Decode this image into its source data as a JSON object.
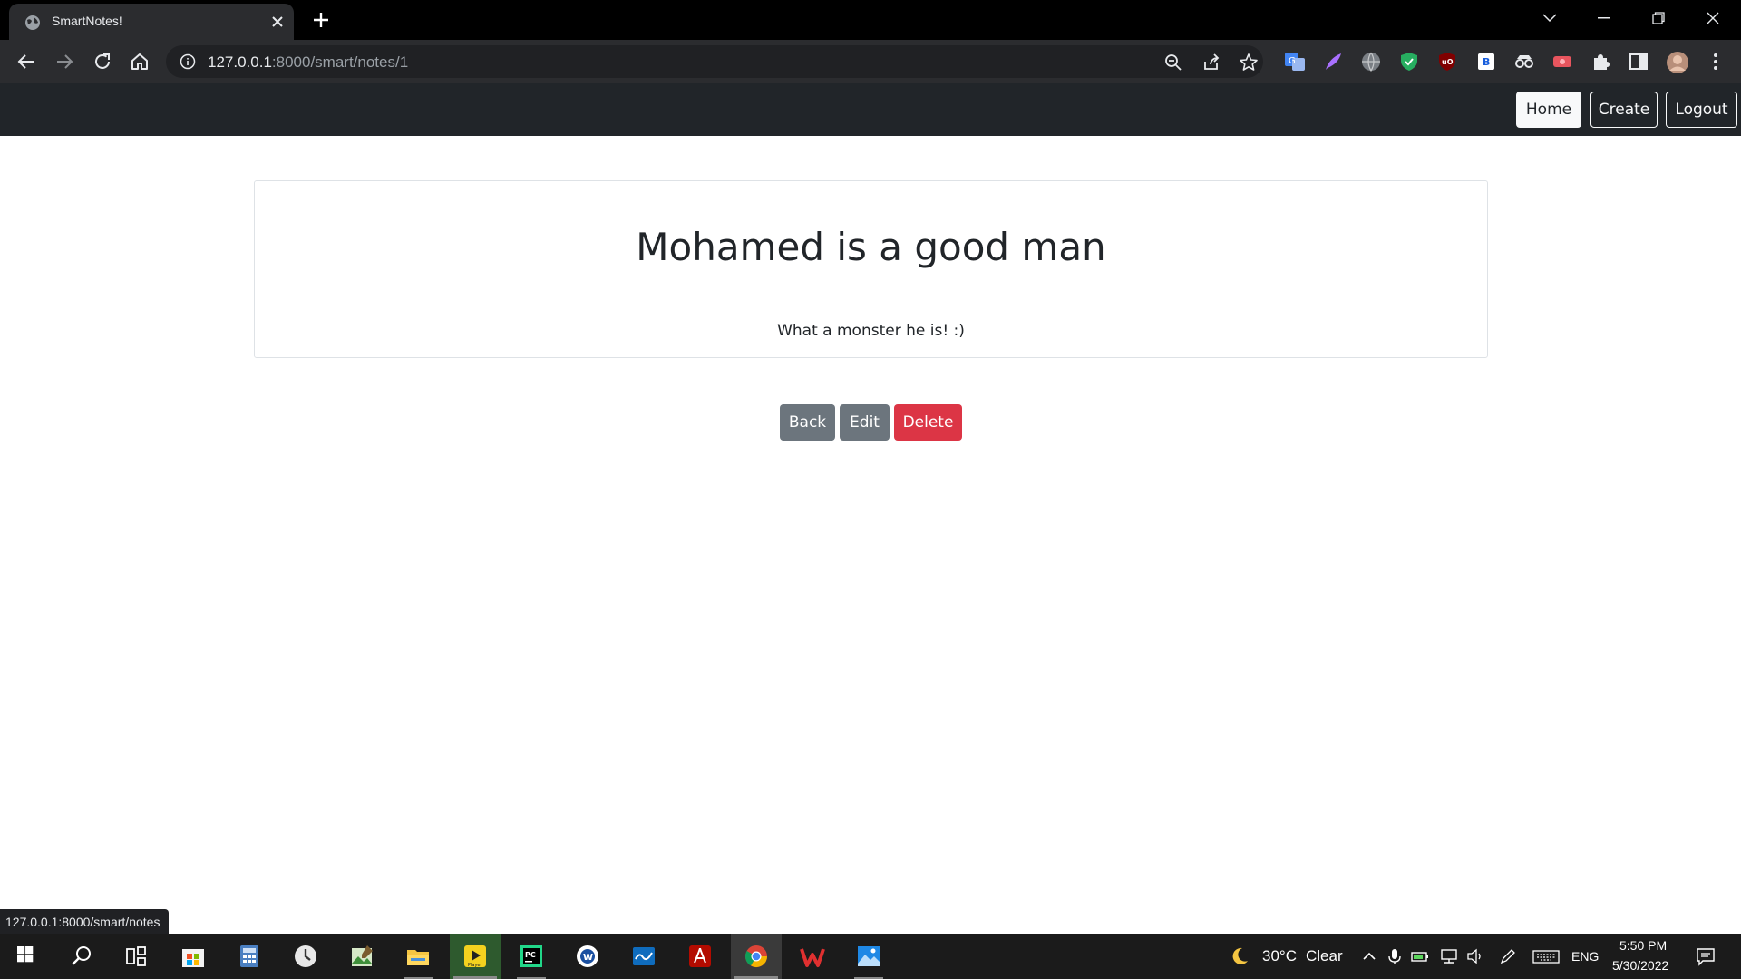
{
  "browser": {
    "tab_title": "SmartNotes!",
    "url_host": "127.0.0.1",
    "url_rest": ":8000/smart/notes/1",
    "status_url": "127.0.0.1:8000/smart/notes"
  },
  "nav": {
    "home_label": "Home",
    "create_label": "Create",
    "logout_label": "Logout"
  },
  "note": {
    "title": "Mohamed is a good man",
    "text": "What a monster he is! :)"
  },
  "actions": {
    "back_label": "Back",
    "edit_label": "Edit",
    "delete_label": "Delete"
  },
  "taskbar": {
    "weather_temp": "30°C",
    "weather_text": "Clear",
    "language": "ENG",
    "time": "5:50 PM",
    "date": "5/30/2022"
  },
  "colors": {
    "navbar_bg": "#212529",
    "secondary": "#6c757d",
    "danger": "#dc3545",
    "chrome_dark": "#202124"
  }
}
